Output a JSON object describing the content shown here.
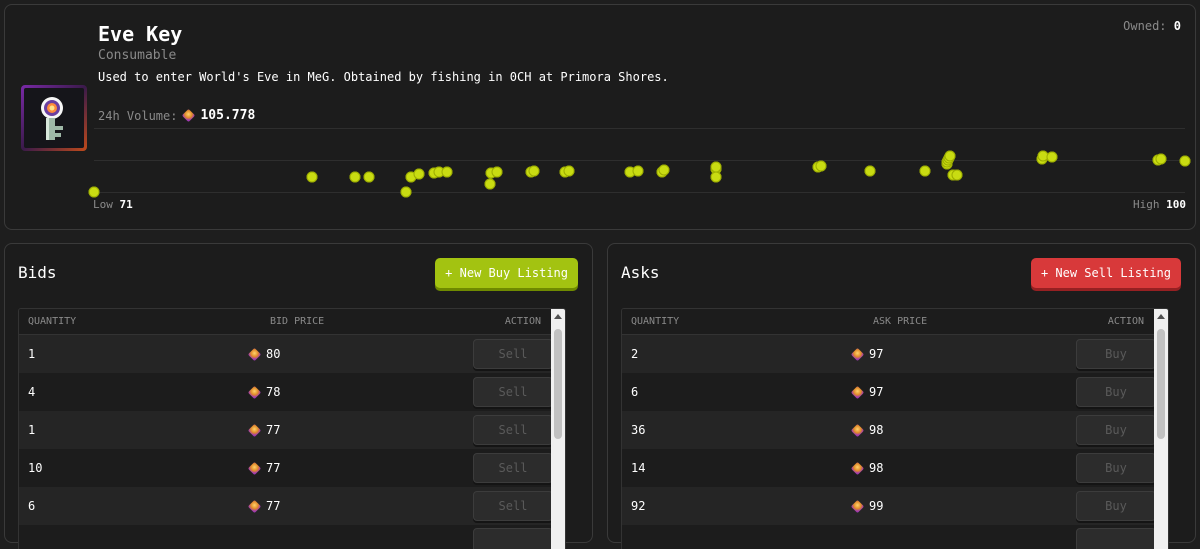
{
  "item": {
    "title": "Eve Key",
    "category": "Consumable",
    "description": "Used to enter World's Eve in MeG. Obtained by fishing in 0CH at Primora Shores.",
    "owned_label": "Owned:",
    "owned_value": "0",
    "icon": "eve-key-icon"
  },
  "volume": {
    "label": "24h Volume:",
    "value": "105.778",
    "icon": "gem-icon"
  },
  "chart_data": {
    "type": "scatter",
    "low_label": "Low",
    "low_value": "71",
    "high_label": "High",
    "high_value": "100",
    "ylim": [
      71,
      100
    ],
    "color": "#c9dc12",
    "points": [
      {
        "x": 0,
        "y": 71
      },
      {
        "x": 20,
        "y": 78
      },
      {
        "x": 23.9,
        "y": 78
      },
      {
        "x": 25.2,
        "y": 78
      },
      {
        "x": 28.6,
        "y": 71
      },
      {
        "x": 29.1,
        "y": 78
      },
      {
        "x": 29.8,
        "y": 79.5
      },
      {
        "x": 31.2,
        "y": 79.7
      },
      {
        "x": 31.6,
        "y": 80
      },
      {
        "x": 32.4,
        "y": 80
      },
      {
        "x": 36.3,
        "y": 74.5
      },
      {
        "x": 36.4,
        "y": 79.7
      },
      {
        "x": 36.9,
        "y": 80
      },
      {
        "x": 40.1,
        "y": 80
      },
      {
        "x": 40.3,
        "y": 80.5
      },
      {
        "x": 43.2,
        "y": 80
      },
      {
        "x": 43.5,
        "y": 80.5
      },
      {
        "x": 49.1,
        "y": 80
      },
      {
        "x": 49.9,
        "y": 80.5
      },
      {
        "x": 52.1,
        "y": 80.3
      },
      {
        "x": 52.2,
        "y": 81
      },
      {
        "x": 57,
        "y": 81.6
      },
      {
        "x": 57,
        "y": 82.7
      },
      {
        "x": 57,
        "y": 78
      },
      {
        "x": 66.4,
        "y": 82.5
      },
      {
        "x": 66.6,
        "y": 83
      },
      {
        "x": 71.1,
        "y": 80.5
      },
      {
        "x": 76.2,
        "y": 80.5
      },
      {
        "x": 78.2,
        "y": 83.7
      },
      {
        "x": 78.2,
        "y": 84.7
      },
      {
        "x": 78.3,
        "y": 85.7
      },
      {
        "x": 78.4,
        "y": 86.7
      },
      {
        "x": 78.5,
        "y": 87.5
      },
      {
        "x": 78.7,
        "y": 79
      },
      {
        "x": 79.1,
        "y": 79
      },
      {
        "x": 86.9,
        "y": 86
      },
      {
        "x": 87,
        "y": 87.7
      },
      {
        "x": 87.8,
        "y": 87
      },
      {
        "x": 97.5,
        "y": 85.7
      },
      {
        "x": 97.8,
        "y": 86
      },
      {
        "x": 100,
        "y": 85.5
      }
    ]
  },
  "bids": {
    "title": "Bids",
    "new_listing_label": "+ New Buy Listing",
    "columns": [
      "QUANTITY",
      "BID PRICE",
      "ACTION"
    ],
    "rows": [
      {
        "qty": "1",
        "price": "80",
        "action": "Sell"
      },
      {
        "qty": "4",
        "price": "78",
        "action": "Sell"
      },
      {
        "qty": "1",
        "price": "77",
        "action": "Sell"
      },
      {
        "qty": "10",
        "price": "77",
        "action": "Sell"
      },
      {
        "qty": "6",
        "price": "77",
        "action": "Sell"
      },
      {
        "qty": "",
        "price": "",
        "action": ""
      }
    ]
  },
  "asks": {
    "title": "Asks",
    "new_listing_label": "+ New Sell Listing",
    "columns": [
      "QUANTITY",
      "ASK PRICE",
      "ACTION"
    ],
    "rows": [
      {
        "qty": "2",
        "price": "97",
        "action": "Buy"
      },
      {
        "qty": "6",
        "price": "97",
        "action": "Buy"
      },
      {
        "qty": "36",
        "price": "98",
        "action": "Buy"
      },
      {
        "qty": "14",
        "price": "98",
        "action": "Buy"
      },
      {
        "qty": "92",
        "price": "99",
        "action": "Buy"
      },
      {
        "qty": "",
        "price": "",
        "action": ""
      }
    ]
  },
  "colors": {
    "accent_green": "#a3c311",
    "accent_red": "#d8393a",
    "dot": "#c9dc12"
  }
}
